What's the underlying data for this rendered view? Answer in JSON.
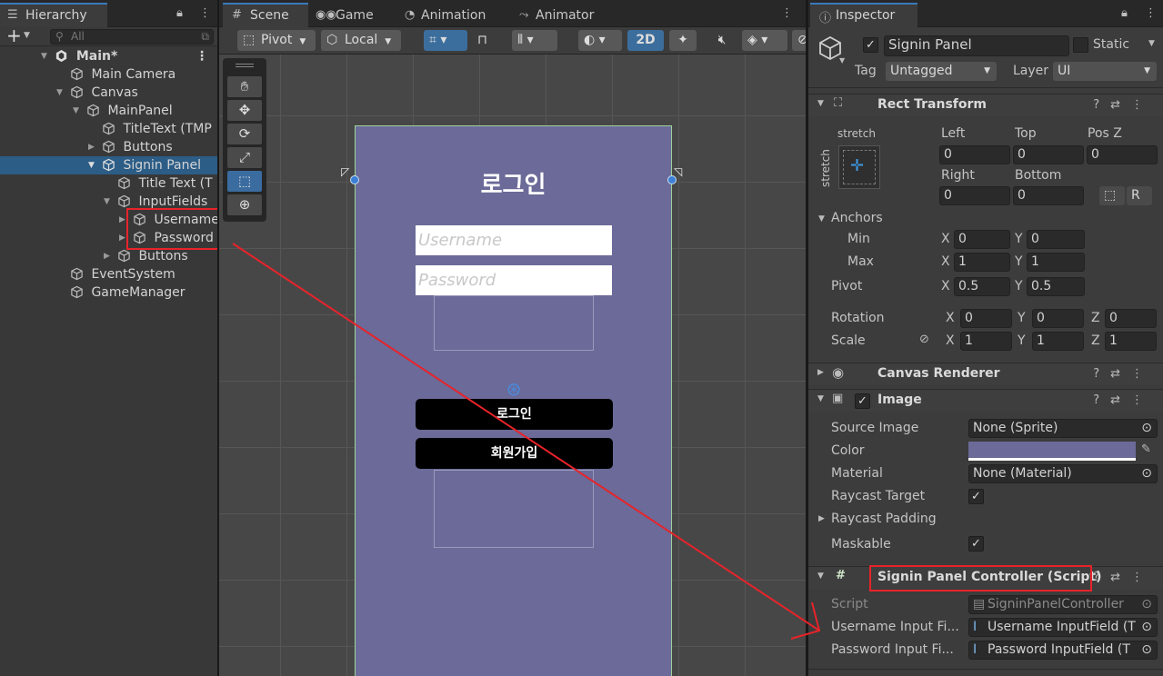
{
  "hierarchy": {
    "tab": "Hierarchy",
    "search_placeholder": "All",
    "add": "+",
    "items": [
      {
        "label": "Main*"
      },
      {
        "label": "Main Camera"
      },
      {
        "label": "Canvas"
      },
      {
        "label": "MainPanel"
      },
      {
        "label": "TitleText (TMP"
      },
      {
        "label": "Buttons"
      },
      {
        "label": "Signin Panel"
      },
      {
        "label": "Title Text (T"
      },
      {
        "label": "InputFields"
      },
      {
        "label": "Username"
      },
      {
        "label": "Password"
      },
      {
        "label": "Buttons"
      },
      {
        "label": "EventSystem"
      },
      {
        "label": "GameManager"
      }
    ]
  },
  "scene": {
    "tabs": [
      "Scene",
      "Game",
      "Animation",
      "Animator"
    ],
    "toolbar": {
      "pivot": "Pivot",
      "local": "Local",
      "mode2d": "2D"
    },
    "canvas": {
      "title": "로그인",
      "username_placeholder": "Username",
      "password_placeholder": "Password",
      "login_button": "로그인",
      "signup_button": "회원가입",
      "color": "#6b6a98"
    }
  },
  "inspector": {
    "tab": "Inspector",
    "object_name": "Signin Panel",
    "static_label": "Static",
    "tag_label": "Tag",
    "tag_value": "Untagged",
    "layer_label": "Layer",
    "layer_value": "UI",
    "rect": {
      "title": "Rect Transform",
      "stretch_top": "stretch",
      "stretch_side": "stretch",
      "left_l": "Left",
      "left_v": "0",
      "top_l": "Top",
      "top_v": "0",
      "posz_l": "Pos Z",
      "posz_v": "0",
      "right_l": "Right",
      "right_v": "0",
      "bottom_l": "Bottom",
      "bottom_v": "0",
      "anchors": "Anchors",
      "min": "Min",
      "max": "Max",
      "pivot": "Pivot",
      "min_x": "0",
      "min_y": "0",
      "max_x": "1",
      "max_y": "1",
      "pivot_x": "0.5",
      "pivot_y": "0.5",
      "rotation": "Rotation",
      "rot_x": "0",
      "rot_y": "0",
      "rot_z": "0",
      "scale": "Scale",
      "scale_x": "1",
      "scale_y": "1",
      "scale_z": "1",
      "x": "X",
      "y": "Y",
      "z": "Z"
    },
    "canvas_renderer": "Canvas Renderer",
    "image": {
      "title": "Image",
      "source_image_l": "Source Image",
      "source_image_v": "None (Sprite)",
      "color_l": "Color",
      "material_l": "Material",
      "material_v": "None (Material)",
      "raycast_target_l": "Raycast Target",
      "raycast_padding_l": "Raycast Padding",
      "maskable_l": "Maskable"
    },
    "script": {
      "title": "Signin Panel Controller (Script)",
      "script_l": "Script",
      "script_v": "SigninPanelController",
      "username_l": "Username Input Fi...",
      "username_v": "Username InputField (T",
      "password_l": "Password Input Fi...",
      "password_v": "Password InputField (T"
    }
  },
  "colors": {
    "accent": "#3a79bb",
    "selection": "#2c5d87",
    "annotation": "#e8232a"
  }
}
